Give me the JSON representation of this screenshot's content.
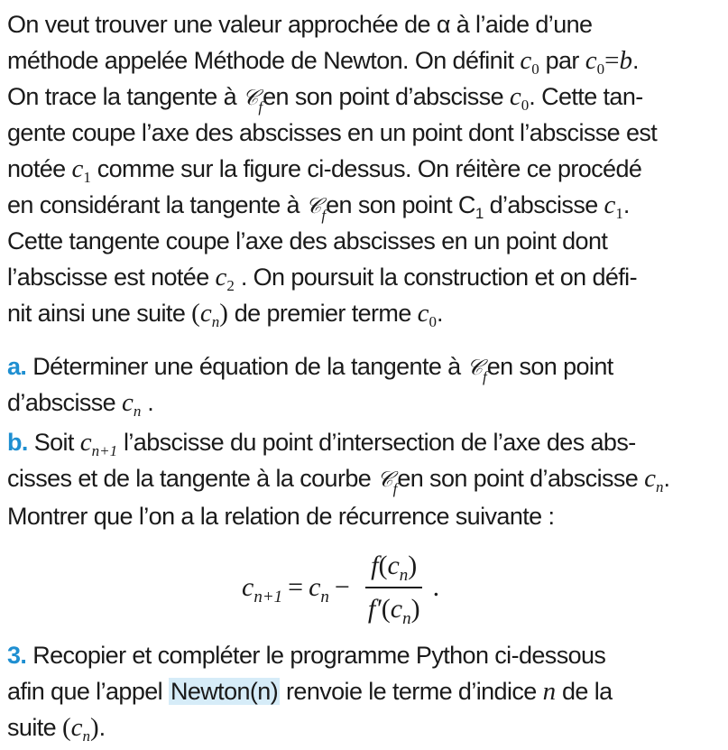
{
  "text": {
    "l1": "On veut trouver une valeur approchée de α à l’aide d’une",
    "l2a": "méthode appelée Méthode de Newton. On définit ",
    "l2b": " par ",
    "l2c": ".",
    "l3a": "On trace la tangente à ",
    "l3b": "en son point d’abscisse ",
    "l3c": ". Cette tan-",
    "l4": "gente coupe l’axe des abscisses en un point dont l’abscisse est",
    "l5a": "notée ",
    "l5b": " comme sur la figure ci-dessus. On réitère ce procédé",
    "l6a": "en considérant la tangente à ",
    "l6b": "en son point C",
    "l6c": " d’abscisse ",
    "l6d": ".",
    "l7": "Cette tangente coupe l’axe des abscisses en un point dont",
    "l8a": "l’abscisse est notée ",
    "l8b": " . On poursuit la construction et on défi-",
    "l9a": "nit ainsi une suite ",
    "l9b": " de premier terme ",
    "l9c": ".",
    "qa_label": "a.",
    "qa1a": " Déterminer une équation de la tangente à ",
    "qa1b": "en son point",
    "qa2a": "d’abscisse ",
    "qa2b": " .",
    "qb_label": "b.",
    "qb1a": " Soit ",
    "qb1b": " l’abscisse du point d’intersection de l’axe des abs-",
    "qb2a": "cisses et de la tangente à la courbe ",
    "qb2b": "en son point d’abscisse ",
    "qb2c": ".",
    "qb3": "Montrer que l’on a la relation de récurrence suivante :",
    "q3_label": "3.",
    "q3_1": " Recopier et compléter le programme Python ci-dessous",
    "q3_2a": "afin que l’appel ",
    "q3_code": "Newton(n)",
    "q3_2b": " renvoie le terme d’indice ",
    "q3_2c": " de la",
    "q3_3a": "suite ",
    "q3_3b": "."
  },
  "math": {
    "c": "c",
    "b": "b",
    "n": "n",
    "f": "f",
    "fprime": "f′",
    "equals": "=",
    "minus": "−",
    "dot": ".",
    "one": "1",
    "zero": "0",
    "two": "2",
    "n_plus_1": "n+1",
    "script_c": "𝒞",
    "open_paren": "(",
    "close_paren": ")"
  },
  "colors": {
    "text": "#1a1a1a",
    "label": "#1f8fd1",
    "highlight": "#d6ecf8"
  }
}
